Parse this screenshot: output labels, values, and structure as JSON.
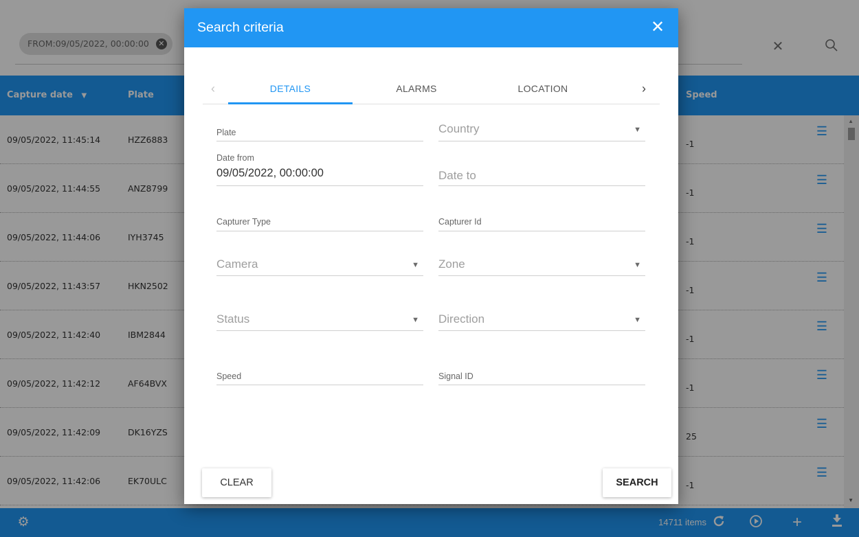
{
  "filter_chip": {
    "label": "FROM:09/05/2022, 00:00:00"
  },
  "table": {
    "headers": {
      "capture_date": "Capture date",
      "plate": "Plate",
      "speed": "Speed"
    },
    "rows": [
      {
        "capture_date": "09/05/2022, 11:45:14",
        "plate": "HZZ6883",
        "speed": "-1"
      },
      {
        "capture_date": "09/05/2022, 11:44:55",
        "plate": "ANZ8799",
        "speed": "-1"
      },
      {
        "capture_date": "09/05/2022, 11:44:06",
        "plate": "IYH3745",
        "speed": "-1"
      },
      {
        "capture_date": "09/05/2022, 11:43:57",
        "plate": "HKN2502",
        "speed": "-1"
      },
      {
        "capture_date": "09/05/2022, 11:42:40",
        "plate": "IBM2844",
        "speed": "-1"
      },
      {
        "capture_date": "09/05/2022, 11:42:12",
        "plate": "AF64BVX",
        "speed": "-1"
      },
      {
        "capture_date": "09/05/2022, 11:42:09",
        "plate": "DK16YZS",
        "speed": "25"
      },
      {
        "capture_date": "09/05/2022, 11:42:06",
        "plate": "EK70ULC",
        "speed": "-1"
      }
    ]
  },
  "footer": {
    "count": "14711 items"
  },
  "dialog": {
    "title": "Search criteria",
    "tabs": [
      "DETAILS",
      "ALARMS",
      "LOCATION"
    ],
    "active_tab": "DETAILS",
    "fields": {
      "plate": "Plate",
      "country": "Country",
      "date_from_label": "Date from",
      "date_from_value": "09/05/2022, 00:00:00",
      "date_to": "Date to",
      "capturer_type": "Capturer Type",
      "capturer_id": "Capturer Id",
      "camera": "Camera",
      "zone": "Zone",
      "status": "Status",
      "direction": "Direction",
      "speed": "Speed",
      "signal_id": "Signal ID"
    },
    "buttons": {
      "clear": "CLEAR",
      "search": "SEARCH"
    }
  },
  "colors": {
    "primary": "#2196f3",
    "overlay": "rgba(0,0,0,0.40)"
  },
  "icons": [
    "chip-remove-icon",
    "clear-icon",
    "search-icon",
    "sort-desc-icon",
    "list-icon",
    "settings-icon",
    "refresh-icon",
    "play-icon",
    "add-icon",
    "download-icon",
    "close-icon",
    "chevron-left-icon",
    "chevron-right-icon",
    "dropdown-arrow-icon"
  ]
}
